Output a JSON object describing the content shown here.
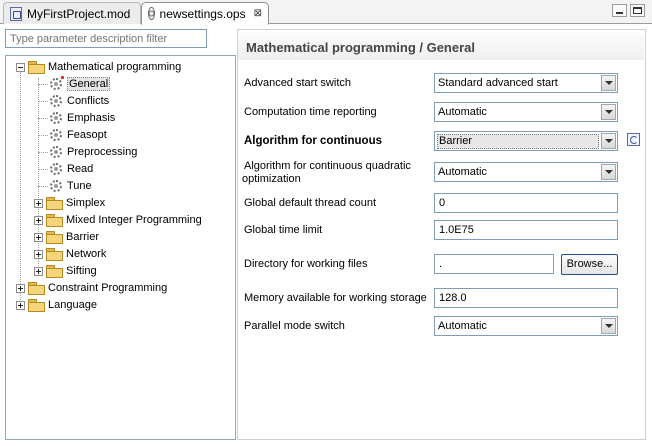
{
  "tabs": [
    {
      "label": "MyFirstProject.mod",
      "icon": "mod-file-icon"
    },
    {
      "label": "newsettings.ops",
      "icon": "ops-file-icon",
      "close": "⊠"
    }
  ],
  "filter": {
    "placeholder": "Type parameter description filter"
  },
  "tree": {
    "root": "Mathematical programming",
    "children": [
      "General",
      "Conflicts",
      "Emphasis",
      "Feasopt",
      "Preprocessing",
      "Read",
      "Tune"
    ],
    "subgroups": [
      "Simplex",
      "Mixed Integer Programming",
      "Barrier",
      "Network",
      "Sifting"
    ],
    "others": [
      "Constraint Programming",
      "Language"
    ]
  },
  "page": {
    "title": "Mathematical programming / General"
  },
  "fields": {
    "advanced_start": {
      "label": "Advanced start switch",
      "value": "Standard advanced start"
    },
    "time_reporting": {
      "label": "Computation time reporting",
      "value": "Automatic"
    },
    "alg_continuous": {
      "label": "Algorithm for continuous",
      "value": "Barrier"
    },
    "alg_qp_line1": "Algorithm for continuous quadratic",
    "alg_qp_line2": "optimization",
    "alg_qp_value": "Automatic",
    "thread_count": {
      "label": "Global default thread count",
      "value": "0"
    },
    "time_limit": {
      "label": "Global time limit",
      "value": "1.0E75"
    },
    "work_dir": {
      "label": "Directory for working files",
      "value": ".",
      "button": "Browse..."
    },
    "memory": {
      "label": "Memory available for working storage",
      "value": "128.0"
    },
    "parallel": {
      "label": "Parallel mode switch",
      "value": "Automatic"
    }
  }
}
